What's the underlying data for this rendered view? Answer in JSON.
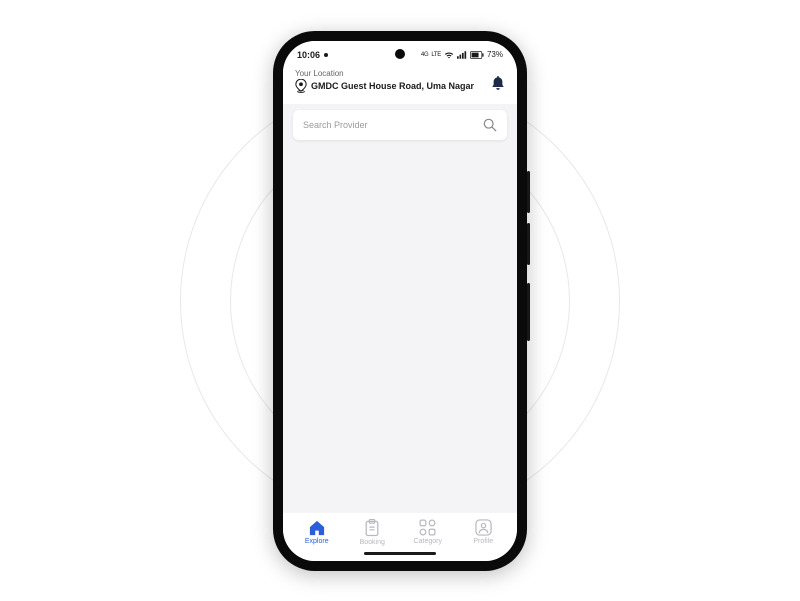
{
  "status": {
    "time": "10:06",
    "net_label_1": "4G",
    "net_label_2": "LTE",
    "battery_pct": "73%"
  },
  "header": {
    "location_label": "Your Location",
    "location_address": "GMDC Guest House Road, Uma Nagar"
  },
  "search": {
    "placeholder": "Search Provider"
  },
  "nav": {
    "items": [
      {
        "key": "explore",
        "label": "Explore",
        "active": true
      },
      {
        "key": "booking",
        "label": "Booking",
        "active": false
      },
      {
        "key": "category",
        "label": "Category",
        "active": false
      },
      {
        "key": "profile",
        "label": "Profile",
        "active": false
      }
    ]
  },
  "colors": {
    "accent": "#2b5fd9",
    "muted": "#b8b8c0",
    "screen_bg": "#f4f4f7"
  }
}
